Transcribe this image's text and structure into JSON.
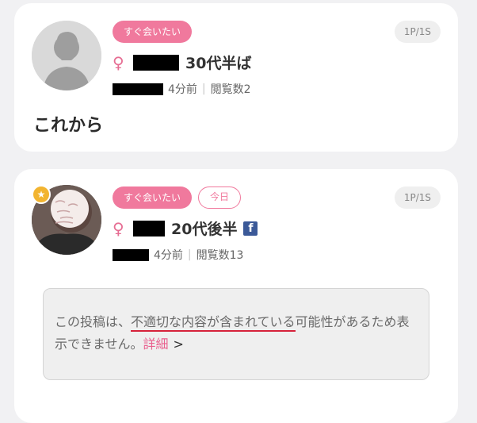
{
  "posts": [
    {
      "tags": [
        "すぐ会いたい"
      ],
      "page": "1P/1S",
      "gender_symbol": "♀",
      "age": "30代半ば",
      "time": "4分前",
      "views": "閲覧数2",
      "text": "これから"
    },
    {
      "tags": [
        "すぐ会いたい",
        "今日"
      ],
      "page": "1P/1S",
      "gender_symbol": "♀",
      "age": "20代後半",
      "facebook_icon": "f",
      "time": "4分前",
      "views": "閲覧数13",
      "warning": {
        "prefix": "この投稿は、",
        "highlight": "不適切な内容が含まれている",
        "suffix": "可能性があるため表示できません。",
        "link": "詳細",
        "chevron": ">"
      }
    }
  ],
  "colors": {
    "accent_pink": "#f0799d",
    "underline_red": "#d6223a",
    "facebook_blue": "#3b5998"
  }
}
